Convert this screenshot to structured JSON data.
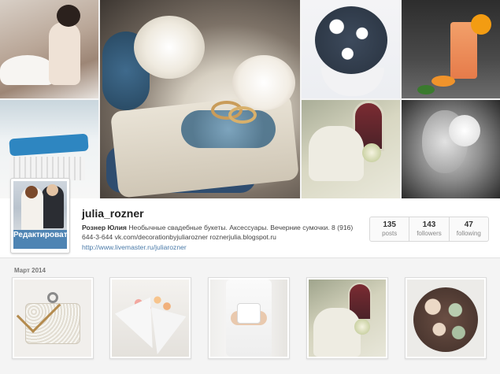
{
  "profile": {
    "username": "julia_rozner",
    "avatar_edit_label": "Редактировать профиль",
    "bio_name": "Рознер Юлия",
    "bio_text": "Необычные свадебные букеты. Аксессуары. Вечерние сумочки. 8 (916) 644-3-644 vk.com/decorationbyjuliarozner roznerjulia.blogspot.ru",
    "website": "http://www.livemaster.ru/juliarozner"
  },
  "stats": [
    {
      "value": "135",
      "label": "posts"
    },
    {
      "value": "143",
      "label": "followers"
    },
    {
      "value": "47",
      "label": "following"
    }
  ],
  "feed": {
    "section_label": "Март 2014"
  }
}
